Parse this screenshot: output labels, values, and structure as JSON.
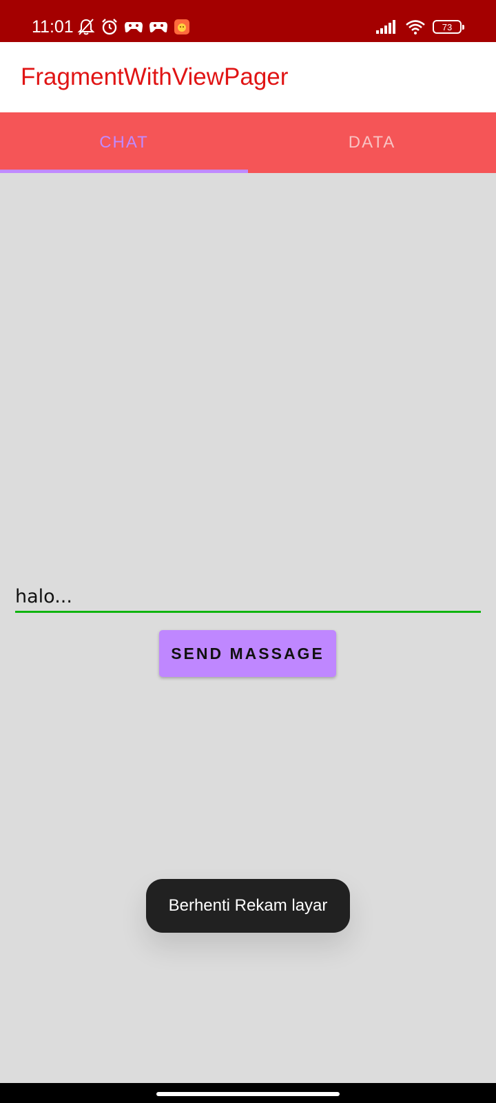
{
  "status_bar": {
    "time": "11:01",
    "left_icons": [
      "muted-bell-icon",
      "alarm-icon",
      "game-controller-icon",
      "game-controller-icon",
      "app-notification-icon"
    ],
    "right_icons": [
      "signal-icon",
      "wifi-icon",
      "battery-icon"
    ],
    "battery_level": "73",
    "background_color": "#a40000"
  },
  "app_bar": {
    "title": "FragmentWithViewPager",
    "title_color": "#e01414"
  },
  "tabs": {
    "items": [
      {
        "label": "CHAT",
        "selected": true
      },
      {
        "label": "DATA",
        "selected": false
      }
    ],
    "background_color": "#f55557",
    "selected_color": "#c08aff"
  },
  "chat": {
    "input_value": "halo...",
    "underline_color": "#0fb40f",
    "send_label": "SEND MASSAGE",
    "send_button_color": "#bf87ff"
  },
  "toast": {
    "message": "Berhenti Rekam layar"
  },
  "nav": {
    "home_indicator": "home-indicator"
  }
}
